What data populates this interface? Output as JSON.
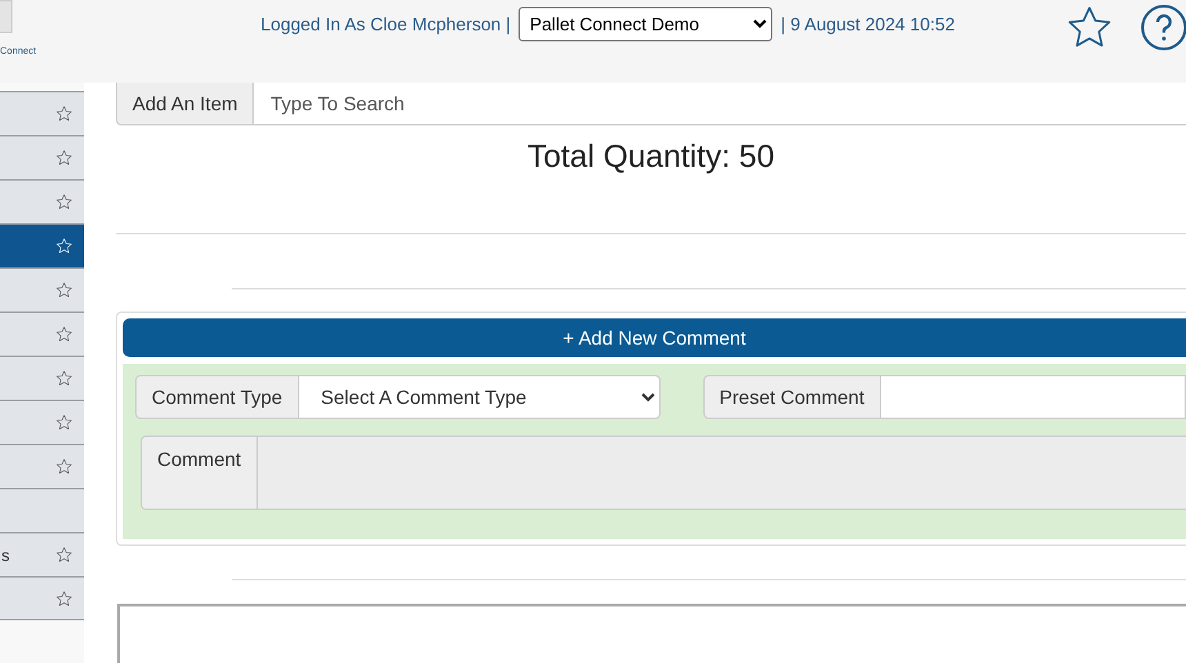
{
  "header": {
    "logo_text": "Connect",
    "user_text": "Logged In As Cloe Mcpherson |",
    "company_select": "Pallet Connect Demo",
    "date_text": "| 9 August 2024 10:52"
  },
  "sidebar": {
    "items": [
      {
        "star_icon": true,
        "selected": false
      },
      {
        "star_icon": true,
        "selected": false
      },
      {
        "star_icon": true,
        "selected": false
      },
      {
        "star_icon": true,
        "selected": true
      },
      {
        "star_icon": true,
        "selected": false
      },
      {
        "star_icon": true,
        "selected": false
      },
      {
        "star_icon": true,
        "selected": false
      },
      {
        "star_icon": true,
        "selected": false
      },
      {
        "star_icon": true,
        "selected": false
      },
      {
        "star_icon": false,
        "selected": false
      },
      {
        "label": "s",
        "star_icon": true,
        "selected": false
      },
      {
        "star_icon": true,
        "selected": false
      }
    ]
  },
  "add_item": {
    "label": "Add An Item",
    "placeholder": "Type To Search"
  },
  "total_quantity": "Total Quantity: 50",
  "comments": {
    "add_button": "+ Add New Comment",
    "comment_type": {
      "label": "Comment Type",
      "value": "Select A Comment Type"
    },
    "preset_comment": {
      "label": "Preset Comment"
    },
    "comment": {
      "label": "Comment"
    }
  }
}
